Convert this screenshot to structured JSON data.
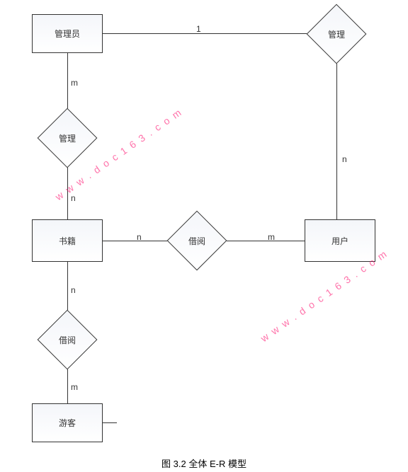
{
  "entities": {
    "admin": "管理员",
    "book": "书籍",
    "user": "用户",
    "guest": "游客"
  },
  "relationships": {
    "manage_top": "管理",
    "manage_left": "管理",
    "borrow_mid": "借阅",
    "borrow_bottom": "借阅"
  },
  "cardinalities": {
    "admin_manage_top": "1",
    "manage_top_user": "n",
    "admin_manage_left": "m",
    "manage_left_book": "n",
    "book_borrow_mid": "n",
    "borrow_mid_user": "m",
    "book_borrow_bottom": "n",
    "borrow_bottom_guest": "m"
  },
  "caption": "图 3.2  全体 E-R 模型",
  "watermark": "w w w . d o c 1 6 3 . c o m",
  "chart_data": {
    "type": "er-diagram",
    "title": "图 3.2  全体 E-R 模型",
    "entities": [
      "管理员",
      "书籍",
      "用户",
      "游客"
    ],
    "relationships": [
      {
        "name": "管理",
        "between": [
          "管理员",
          "用户"
        ],
        "cardinality": {
          "管理员": "1",
          "用户": "n"
        }
      },
      {
        "name": "管理",
        "between": [
          "管理员",
          "书籍"
        ],
        "cardinality": {
          "管理员": "m",
          "书籍": "n"
        }
      },
      {
        "name": "借阅",
        "between": [
          "书籍",
          "用户"
        ],
        "cardinality": {
          "书籍": "n",
          "用户": "m"
        }
      },
      {
        "name": "借阅",
        "between": [
          "书籍",
          "游客"
        ],
        "cardinality": {
          "书籍": "n",
          "游客": "m"
        }
      }
    ]
  }
}
